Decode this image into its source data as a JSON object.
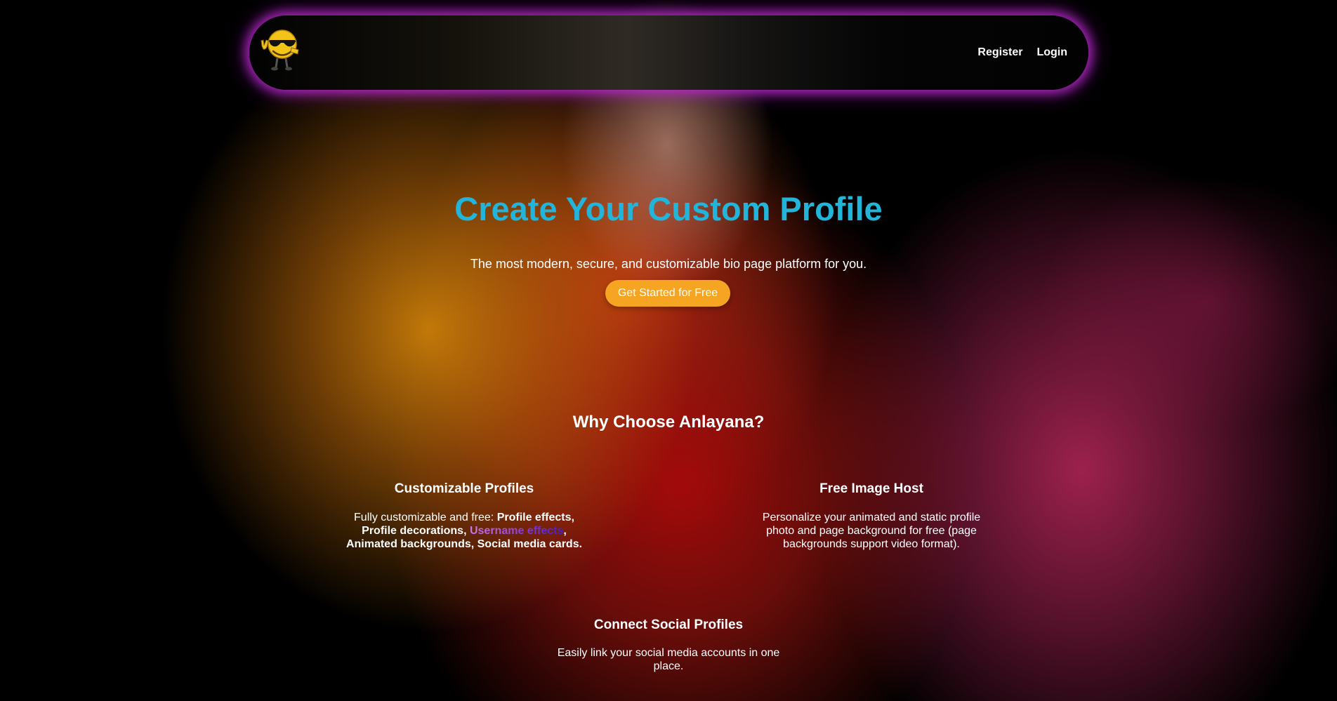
{
  "header": {
    "logo_icon": "sunglasses-emoji-logo",
    "nav": {
      "register_label": "Register",
      "login_label": "Login"
    }
  },
  "hero": {
    "title": "Create Your Custom Profile",
    "subtitle": "The most modern, secure, and customizable bio page platform for you.",
    "cta_label": "Get Started for Free"
  },
  "why": {
    "title": "Why Choose Anlayana?"
  },
  "features": [
    {
      "title": "Customizable Profiles",
      "desc_intro": "Fully customizable and free: ",
      "desc_bold_1": "Profile effects, Profile decorations, ",
      "desc_highlight": "Username effects",
      "desc_comma": ", ",
      "desc_bold_2": "Animated backgrounds, Social media cards."
    },
    {
      "title": "Free Image Host",
      "desc": "Personalize your animated and static profile photo and page background for free (page backgrounds support video format)."
    },
    {
      "title": "Connect Social Profiles",
      "desc": "Easily link your social media accounts in one place."
    }
  ],
  "colors": {
    "title_accent": "#22b4d9",
    "cta_background": "#f5a521",
    "navbar_glow": "#c32dd7"
  }
}
